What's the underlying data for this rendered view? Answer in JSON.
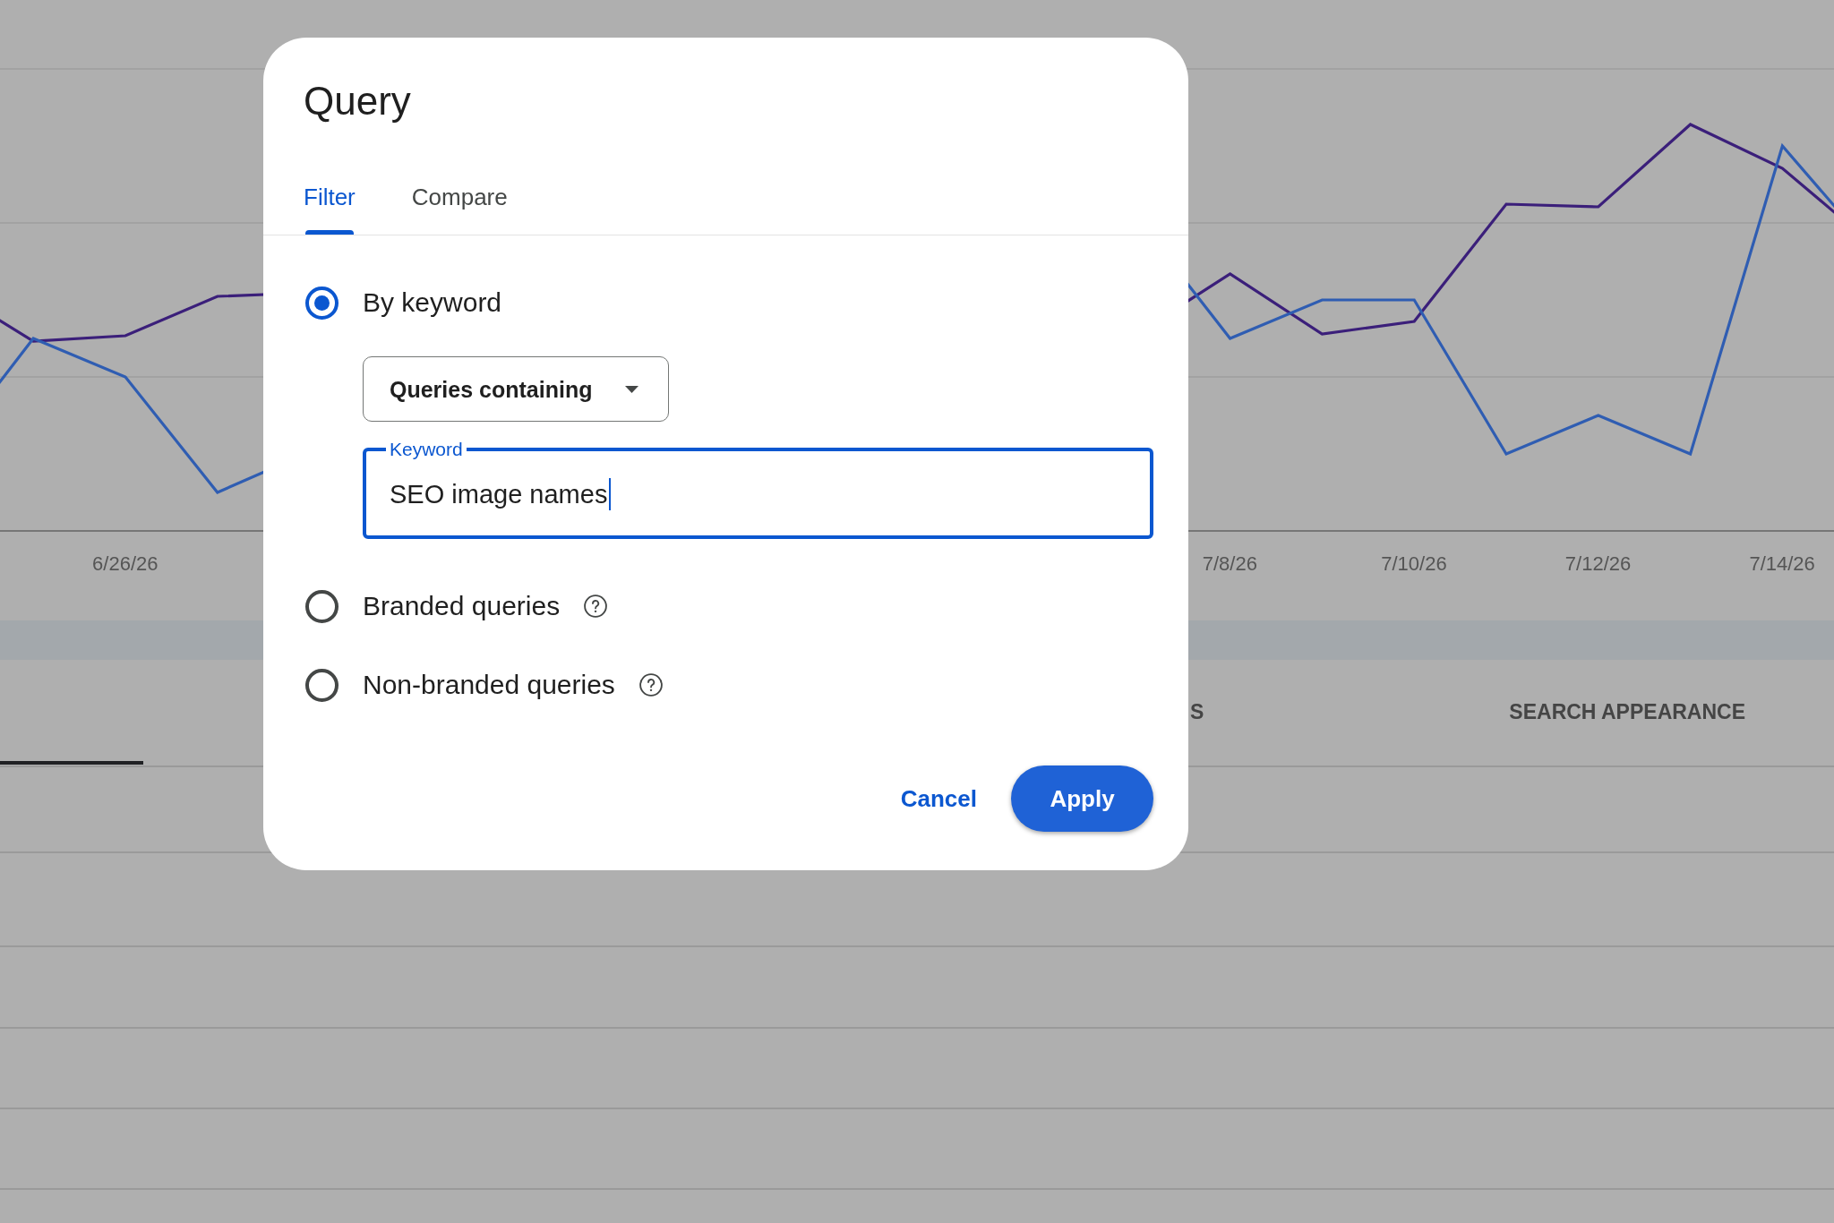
{
  "chart": {
    "x_axis_labels": [
      "6/26/26",
      "7/8/26",
      "7/10/26",
      "7/12/26",
      "7/14/26"
    ]
  },
  "report_tabs": [
    {
      "selected": true
    },
    {
      "label": "S",
      "selected": false
    },
    {
      "label": "SEARCH APPEARANCE",
      "selected": false
    }
  ],
  "dialog": {
    "title": "Query",
    "tabs": [
      {
        "label": "Filter",
        "selected": true
      },
      {
        "label": "Compare",
        "selected": false
      }
    ],
    "options": [
      {
        "label": "By keyword",
        "selected": true,
        "help_icon": false,
        "match_type": "Queries containing",
        "keyword_field": {
          "label": "Keyword",
          "value": "SEO image names",
          "focused": true
        }
      },
      {
        "label": "Branded queries",
        "selected": false,
        "help_icon": true
      },
      {
        "label": "Non-branded queries",
        "selected": false,
        "help_icon": true
      }
    ],
    "buttons": [
      {
        "label": "Cancel",
        "kind": "text"
      },
      {
        "label": "Apply",
        "kind": "filled"
      }
    ]
  }
}
